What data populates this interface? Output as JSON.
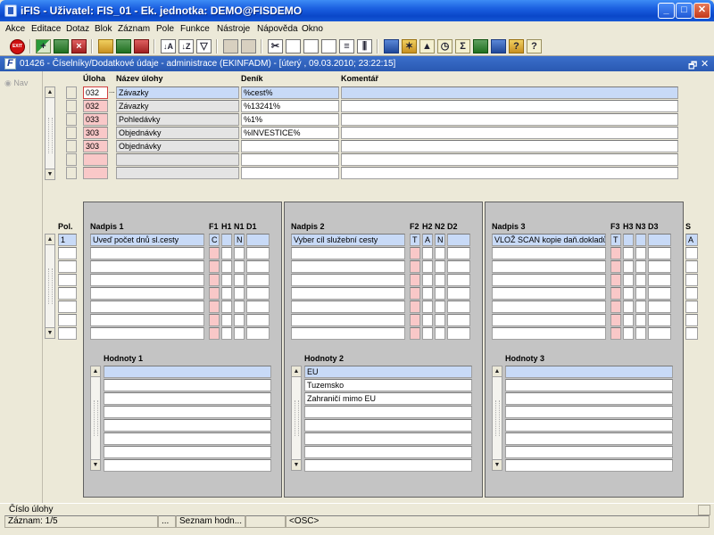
{
  "window": {
    "title": "iFIS - Uživatel: FIS_01 - Ek. jednotka: DEMO@FISDEMO",
    "minimize": "_",
    "maximize": "□",
    "close": "✕"
  },
  "menu": [
    "Akce",
    "Editace",
    "Dotaz",
    "Blok",
    "Záznam",
    "Pole",
    "Funkce",
    "Nástroje",
    "Nápověda",
    "Okno"
  ],
  "toolbar": {
    "exit": "EXIT"
  },
  "form": {
    "title": "01426 - Číselníky/Dodatkové údaje - administrace (EKINFADM) - [úterý , 09.03.2010; 23:22:15]",
    "nav_label": "Nav",
    "restore": "🗗",
    "close": "✕"
  },
  "top_grid": {
    "headers": {
      "uloha": "Úloha",
      "nazev": "Název úlohy",
      "denik": "Deník",
      "komentar": "Komentář"
    },
    "more_button": "...",
    "rows": [
      {
        "uloha": "032",
        "nazev": "Závazky",
        "denik": "%cest%",
        "komentar": ""
      },
      {
        "uloha": "032",
        "nazev": "Závazky",
        "denik": "%13241%",
        "komentar": ""
      },
      {
        "uloha": "033",
        "nazev": "Pohledávky",
        "denik": "%1%",
        "komentar": ""
      },
      {
        "uloha": "303",
        "nazev": "Objednávky",
        "denik": "%INVESTICE%",
        "komentar": ""
      },
      {
        "uloha": "303",
        "nazev": "Objednávky",
        "denik": "",
        "komentar": ""
      },
      {
        "uloha": "",
        "nazev": "",
        "denik": "",
        "komentar": ""
      },
      {
        "uloha": "",
        "nazev": "",
        "denik": "",
        "komentar": ""
      }
    ]
  },
  "pol": {
    "header": "Pol.",
    "values": [
      "1",
      "",
      "",
      "",
      "",
      "",
      "",
      ""
    ]
  },
  "s_col": {
    "header": "S",
    "values": [
      "A",
      "",
      "",
      "",
      "",
      "",
      "",
      ""
    ]
  },
  "panels": [
    {
      "heading": "Nadpis 1",
      "flags": [
        "F1",
        "H1",
        "N1",
        "D1"
      ],
      "rows": [
        {
          "text": "Uveď počet dnů sl.cesty",
          "f": "C",
          "h": "",
          "n": "N",
          "d": ""
        },
        {
          "text": "",
          "f": "",
          "h": "",
          "n": "",
          "d": ""
        },
        {
          "text": "",
          "f": "",
          "h": "",
          "n": "",
          "d": ""
        },
        {
          "text": "",
          "f": "",
          "h": "",
          "n": "",
          "d": ""
        },
        {
          "text": "",
          "f": "",
          "h": "",
          "n": "",
          "d": ""
        },
        {
          "text": "",
          "f": "",
          "h": "",
          "n": "",
          "d": ""
        },
        {
          "text": "",
          "f": "",
          "h": "",
          "n": "",
          "d": ""
        },
        {
          "text": "",
          "f": "",
          "h": "",
          "n": "",
          "d": ""
        }
      ],
      "values_heading": "Hodnoty 1",
      "values": [
        "",
        "",
        "",
        "",
        "",
        "",
        "",
        ""
      ]
    },
    {
      "heading": "Nadpis 2",
      "flags": [
        "F2",
        "H2",
        "N2",
        "D2"
      ],
      "rows": [
        {
          "text": "Vyber cíl služební cesty",
          "f": "T",
          "h": "A",
          "n": "N",
          "d": ""
        },
        {
          "text": "",
          "f": "",
          "h": "",
          "n": "",
          "d": ""
        },
        {
          "text": "",
          "f": "",
          "h": "",
          "n": "",
          "d": ""
        },
        {
          "text": "",
          "f": "",
          "h": "",
          "n": "",
          "d": ""
        },
        {
          "text": "",
          "f": "",
          "h": "",
          "n": "",
          "d": ""
        },
        {
          "text": "",
          "f": "",
          "h": "",
          "n": "",
          "d": ""
        },
        {
          "text": "",
          "f": "",
          "h": "",
          "n": "",
          "d": ""
        },
        {
          "text": "",
          "f": "",
          "h": "",
          "n": "",
          "d": ""
        }
      ],
      "values_heading": "Hodnoty 2",
      "values": [
        "EU",
        "Tuzemsko",
        "Zahraničí mimo EU",
        "",
        "",
        "",
        "",
        ""
      ]
    },
    {
      "heading": "Nadpis 3",
      "flags": [
        "F3",
        "H3",
        "N3",
        "D3"
      ],
      "rows": [
        {
          "text": "VLOŽ SCAN kopie daň.dokladů",
          "f": "T",
          "h": "",
          "n": "",
          "d": ""
        },
        {
          "text": "",
          "f": "",
          "h": "",
          "n": "",
          "d": ""
        },
        {
          "text": "",
          "f": "",
          "h": "",
          "n": "",
          "d": ""
        },
        {
          "text": "",
          "f": "",
          "h": "",
          "n": "",
          "d": ""
        },
        {
          "text": "",
          "f": "",
          "h": "",
          "n": "",
          "d": ""
        },
        {
          "text": "",
          "f": "",
          "h": "",
          "n": "",
          "d": ""
        },
        {
          "text": "",
          "f": "",
          "h": "",
          "n": "",
          "d": ""
        },
        {
          "text": "",
          "f": "",
          "h": "",
          "n": "",
          "d": ""
        }
      ],
      "values_heading": "Hodnoty 3",
      "values": [
        "",
        "",
        "",
        "",
        "",
        "",
        "",
        ""
      ]
    }
  ],
  "status": {
    "hint": "Číslo úlohy",
    "record": "Záznam: 1/5",
    "dots": "...",
    "list": "Seznam hodn...",
    "osc": "<OSC>"
  },
  "colors": {
    "title_blue": "#0a47c9",
    "selected_row": "#c8daf7",
    "required_field": "#f9c8c8",
    "panel_gray": "#c4c4c4"
  }
}
